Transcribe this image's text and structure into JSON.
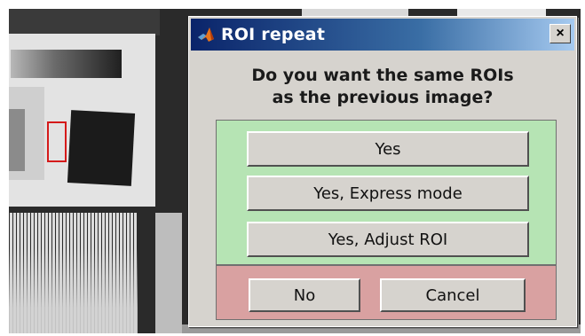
{
  "dialog": {
    "title": "ROI repeat",
    "title_icon": "matlab-icon",
    "close_glyph": "×",
    "question_line1": "Do you want the same ROIs",
    "question_line2": "as the previous image?",
    "buttons": {
      "yes": "Yes",
      "express": "Yes, Express mode",
      "adjust": "Yes, Adjust ROI",
      "no": "No",
      "cancel": "Cancel"
    }
  },
  "colors": {
    "title_bar_start": "#0a246a",
    "title_bar_end": "#a6caf0",
    "dialog_face": "#d6d3ce",
    "green_panel": "#b6e4b4",
    "red_panel": "#d9a1a1",
    "roi_box": "#d51a1a"
  }
}
